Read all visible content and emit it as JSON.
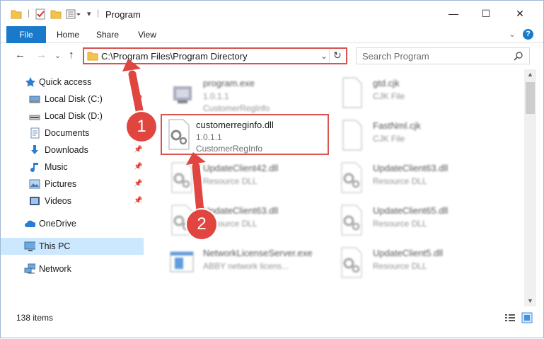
{
  "window": {
    "title": "Program",
    "minimize": "—",
    "maximize": "☐",
    "close": "✕"
  },
  "ribbon": {
    "tabs": [
      "File",
      "Home",
      "Share",
      "View"
    ],
    "help": "?"
  },
  "nav": {
    "address": "C:\\Program Files\\Program Directory",
    "search_placeholder": "Search Program"
  },
  "sidebar": {
    "items": [
      {
        "label": "Quick access",
        "icon": "star-icon"
      },
      {
        "label": "Local Disk (C:)",
        "icon": "drive-icon"
      },
      {
        "label": "Local Disk (D:)",
        "icon": "drive-icon"
      },
      {
        "label": "Documents",
        "icon": "documents-icon"
      },
      {
        "label": "Downloads",
        "icon": "downloads-icon"
      },
      {
        "label": "Music",
        "icon": "music-icon"
      },
      {
        "label": "Pictures",
        "icon": "pictures-icon"
      },
      {
        "label": "Videos",
        "icon": "videos-icon"
      },
      {
        "label": "OneDrive",
        "icon": "cloud-icon"
      },
      {
        "label": "This PC",
        "icon": "computer-icon"
      },
      {
        "label": "Network",
        "icon": "network-icon"
      }
    ]
  },
  "files": [
    {
      "name": "program.exe",
      "l2": "1.0.1.1",
      "l3": "CustomerRegInfo",
      "icon": "exe-icon"
    },
    {
      "name": "gtd.cjk",
      "l2": "CJK File",
      "l3": "",
      "icon": "blank-file-icon"
    },
    {
      "name": "customerreginfo.dll",
      "l2": "1.0.1.1",
      "l3": "CustomerRegInfo",
      "icon": "dll-gear-icon"
    },
    {
      "name": "FastNml.cjk",
      "l2": "CJK File",
      "l3": "",
      "icon": "blank-file-icon"
    },
    {
      "name": "UpdateClient42.dll",
      "l2": "Resource DLL",
      "l3": "",
      "icon": "dll-gear-icon"
    },
    {
      "name": "UpdateClient63.dll",
      "l2": "Resource DLL",
      "l3": "",
      "icon": "dll-gear-icon"
    },
    {
      "name": "UpdateClient63.dll",
      "l2": "Resource DLL",
      "l3": "",
      "icon": "dll-gear-icon"
    },
    {
      "name": "UpdateClient65.dll",
      "l2": "Resource DLL",
      "l3": "",
      "icon": "dll-gear-icon"
    },
    {
      "name": "NetworkLicenseServer.exe",
      "l2": "ABBY network licens...",
      "l3": "",
      "icon": "exe-icon"
    },
    {
      "name": "UpdateClient5.dll",
      "l2": "Resource DLL",
      "l3": "",
      "icon": "dll-gear-icon"
    }
  ],
  "status": {
    "count": "138 items"
  },
  "annotations": {
    "step1": "1",
    "step2": "2"
  },
  "colors": {
    "accent": "#1979ca",
    "highlight": "#d9534f",
    "selected": "#cce8ff",
    "arrow": "#e0463f"
  }
}
